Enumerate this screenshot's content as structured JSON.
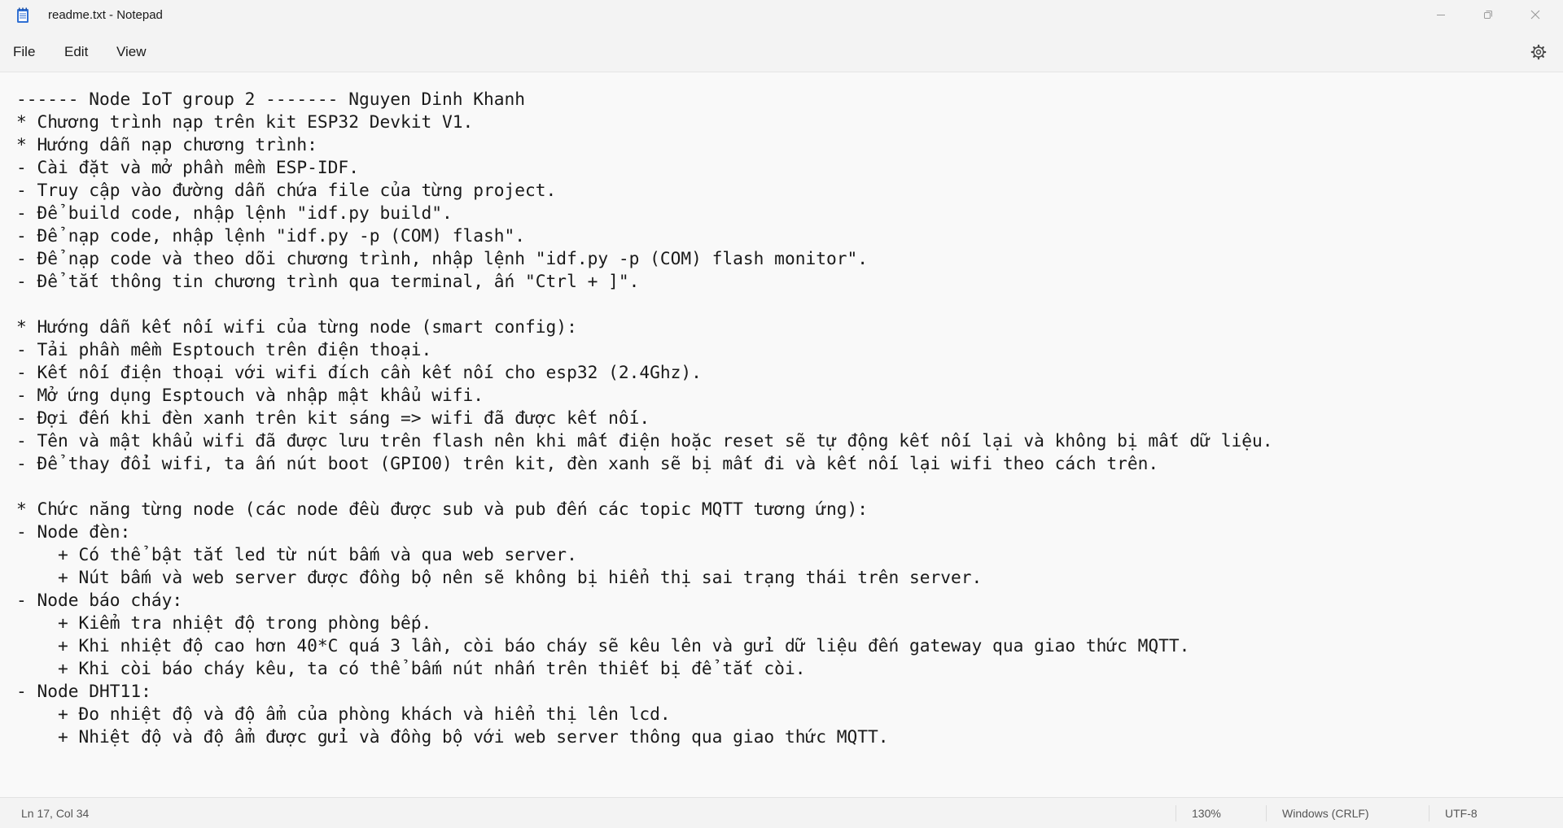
{
  "window": {
    "title": "readme.txt - Notepad",
    "controls": {
      "minimize": "minimize-icon",
      "maximize": "restore-icon",
      "close": "close-icon"
    }
  },
  "menu": {
    "file": "File",
    "edit": "Edit",
    "view": "View",
    "settings_icon": "gear-icon"
  },
  "editor": {
    "content": "------ Node IoT group 2 ------- Nguyen Dinh Khanh\n* Chương trình nạp trên kit ESP32 Devkit V1.\n* Hướng dẫn nạp chương trình:\n- Cài đặt và mở phần mềm ESP-IDF.\n- Truy cập vào đường dẫn chứa file của từng project.\n- Để build code, nhập lệnh \"idf.py build\".\n- Để nạp code, nhập lệnh \"idf.py -p (COM) flash\".\n- Để nạp code và theo dõi chương trình, nhập lệnh \"idf.py -p (COM) flash monitor\".\n- Để tắt thông tin chương trình qua terminal, ấn \"Ctrl + ]\".\n\n* Hướng dẫn kết nối wifi của từng node (smart config):\n- Tải phần mềm Esptouch trên điện thoại.\n- Kết nối điện thoại với wifi đích cần kết nối cho esp32 (2.4Ghz).\n- Mở ứng dụng Esptouch và nhập mật khẩu wifi.\n- Đợi đến khi đèn xanh trên kit sáng => wifi đã được kết nối.\n- Tên và mật khẩu wifi đã được lưu trên flash nên khi mất điện hoặc reset sẽ tự động kết nối lại và không bị mất dữ liệu.\n- Để thay đổi wifi, ta ấn nút boot (GPIO0) trên kit, đèn xanh sẽ bị mất đi và kết nối lại wifi theo cách trên.\n\n* Chức năng từng node (các node đều được sub và pub đến các topic MQTT tương ứng):\n- Node đèn:\n    + Có thể bật tắt led từ nút bấm và qua web server.\n    + Nút bấm và web server được đồng bộ nên sẽ không bị hiển thị sai trạng thái trên server.\n- Node báo cháy:\n    + Kiểm tra nhiệt độ trong phòng bếp.\n    + Khi nhiệt độ cao hơn 40*C quá 3 lần, còi báo cháy sẽ kêu lên và gửi dữ liệu đến gateway qua giao thức MQTT.\n    + Khi còi báo cháy kêu, ta có thể bấm nút nhấn trên thiết bị để tắt còi.\n- Node DHT11:\n    + Đo nhiệt độ và độ ẩm của phòng khách và hiển thị lên lcd.\n    + Nhiệt độ và độ ẩm được gửi và đồng bộ với web server thông qua giao thức MQTT."
  },
  "status": {
    "position": "Ln 17, Col 34",
    "zoom": "130%",
    "line_ending": "Windows (CRLF)",
    "encoding": "UTF-8"
  },
  "colors": {
    "background": "#f9f9f9",
    "chrome": "#f3f3f3",
    "text": "#1a1a1a"
  }
}
